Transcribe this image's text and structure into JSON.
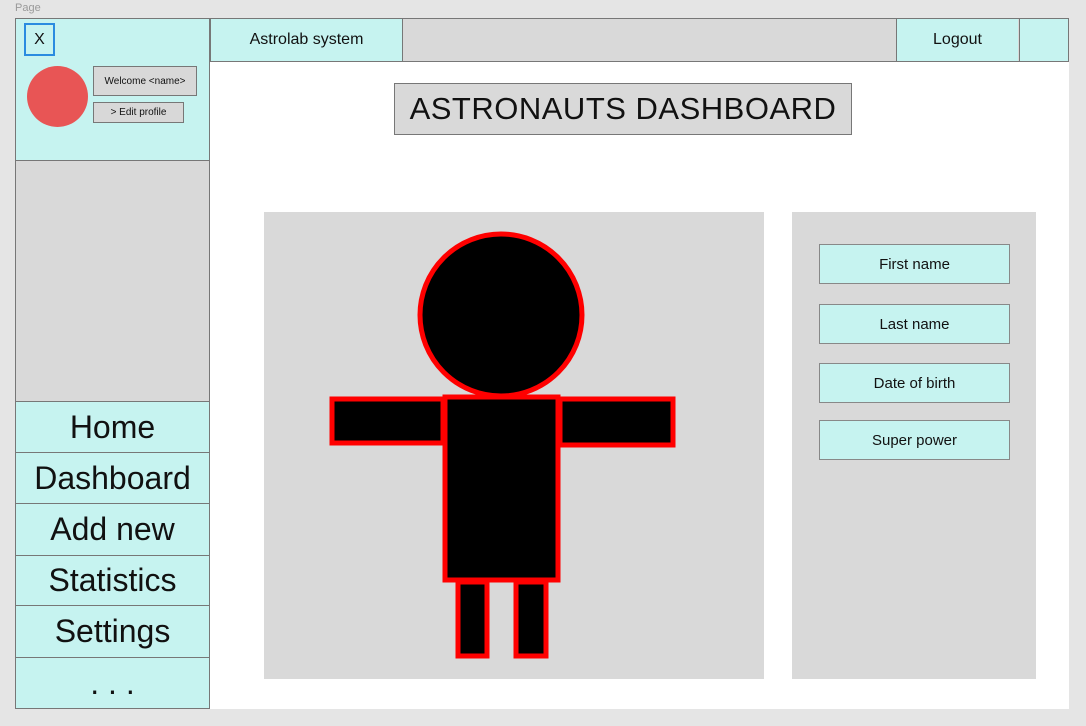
{
  "page_label": "Page",
  "sidebar": {
    "close_label": "X",
    "welcome": "Welcome <name>",
    "edit_profile": "> Edit profile",
    "nav": [
      "Home",
      "Dashboard",
      "Add new",
      "Statistics",
      "Settings",
      ". . ."
    ]
  },
  "topbar": {
    "app_title": "Astrolab system",
    "logout": "Logout"
  },
  "main": {
    "title": "ASTRONAUTS DASHBOARD",
    "fields": [
      "First name",
      "Last name",
      "Date of birth",
      "Super power"
    ]
  },
  "colors": {
    "panel_cyan": "#c6f3f0",
    "panel_gray": "#d9d9d9",
    "avatar": "#e85555",
    "figure_outline": "#ff0000",
    "figure_fill": "#000000"
  }
}
